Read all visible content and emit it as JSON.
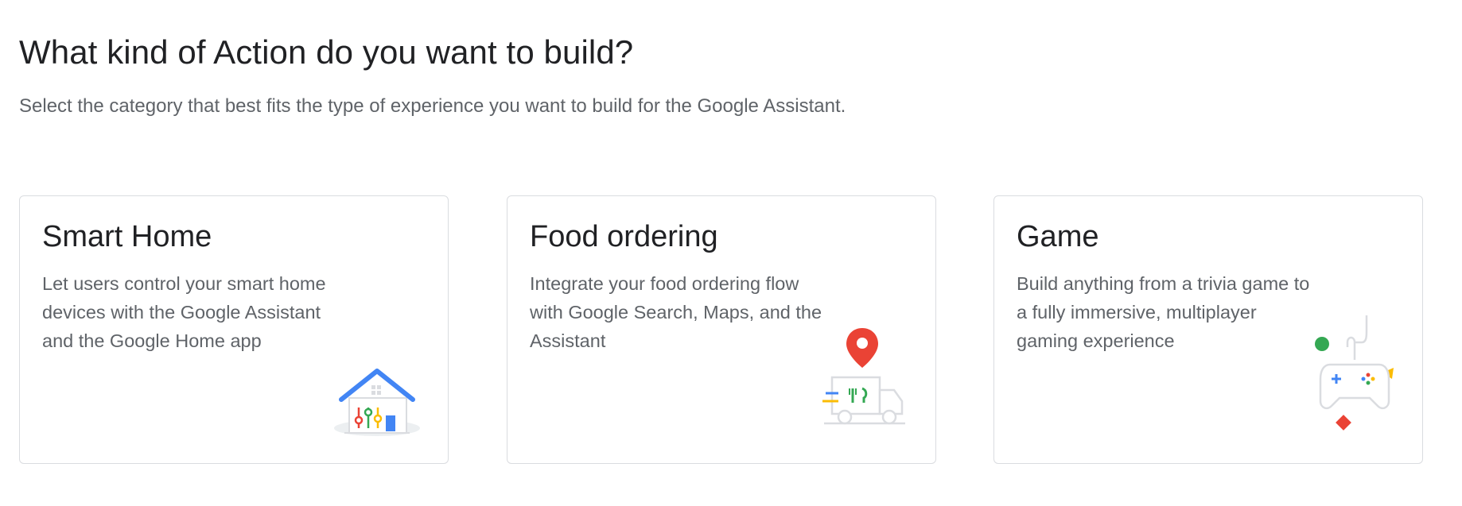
{
  "header": {
    "title": "What kind of Action do you want to build?",
    "subtitle": "Select the category that best fits the type of experience you want to build for the Google Assistant."
  },
  "cards": [
    {
      "title": "Smart Home",
      "description": "Let users control your smart home devices with the Google Assistant and the Google Home app",
      "icon": "smart-home-icon"
    },
    {
      "title": "Food ordering",
      "description": "Integrate your food ordering flow with Google Search, Maps, and the Assistant",
      "icon": "food-delivery-icon"
    },
    {
      "title": "Game",
      "description": "Build anything from a trivia game to a fully immersive, multiplayer gaming experience",
      "icon": "game-controller-icon"
    }
  ],
  "colors": {
    "blue": "#4285f4",
    "red": "#ea4335",
    "yellow": "#fbbc04",
    "green": "#34a853",
    "border": "#dadce0",
    "text_secondary": "#5f6368"
  }
}
